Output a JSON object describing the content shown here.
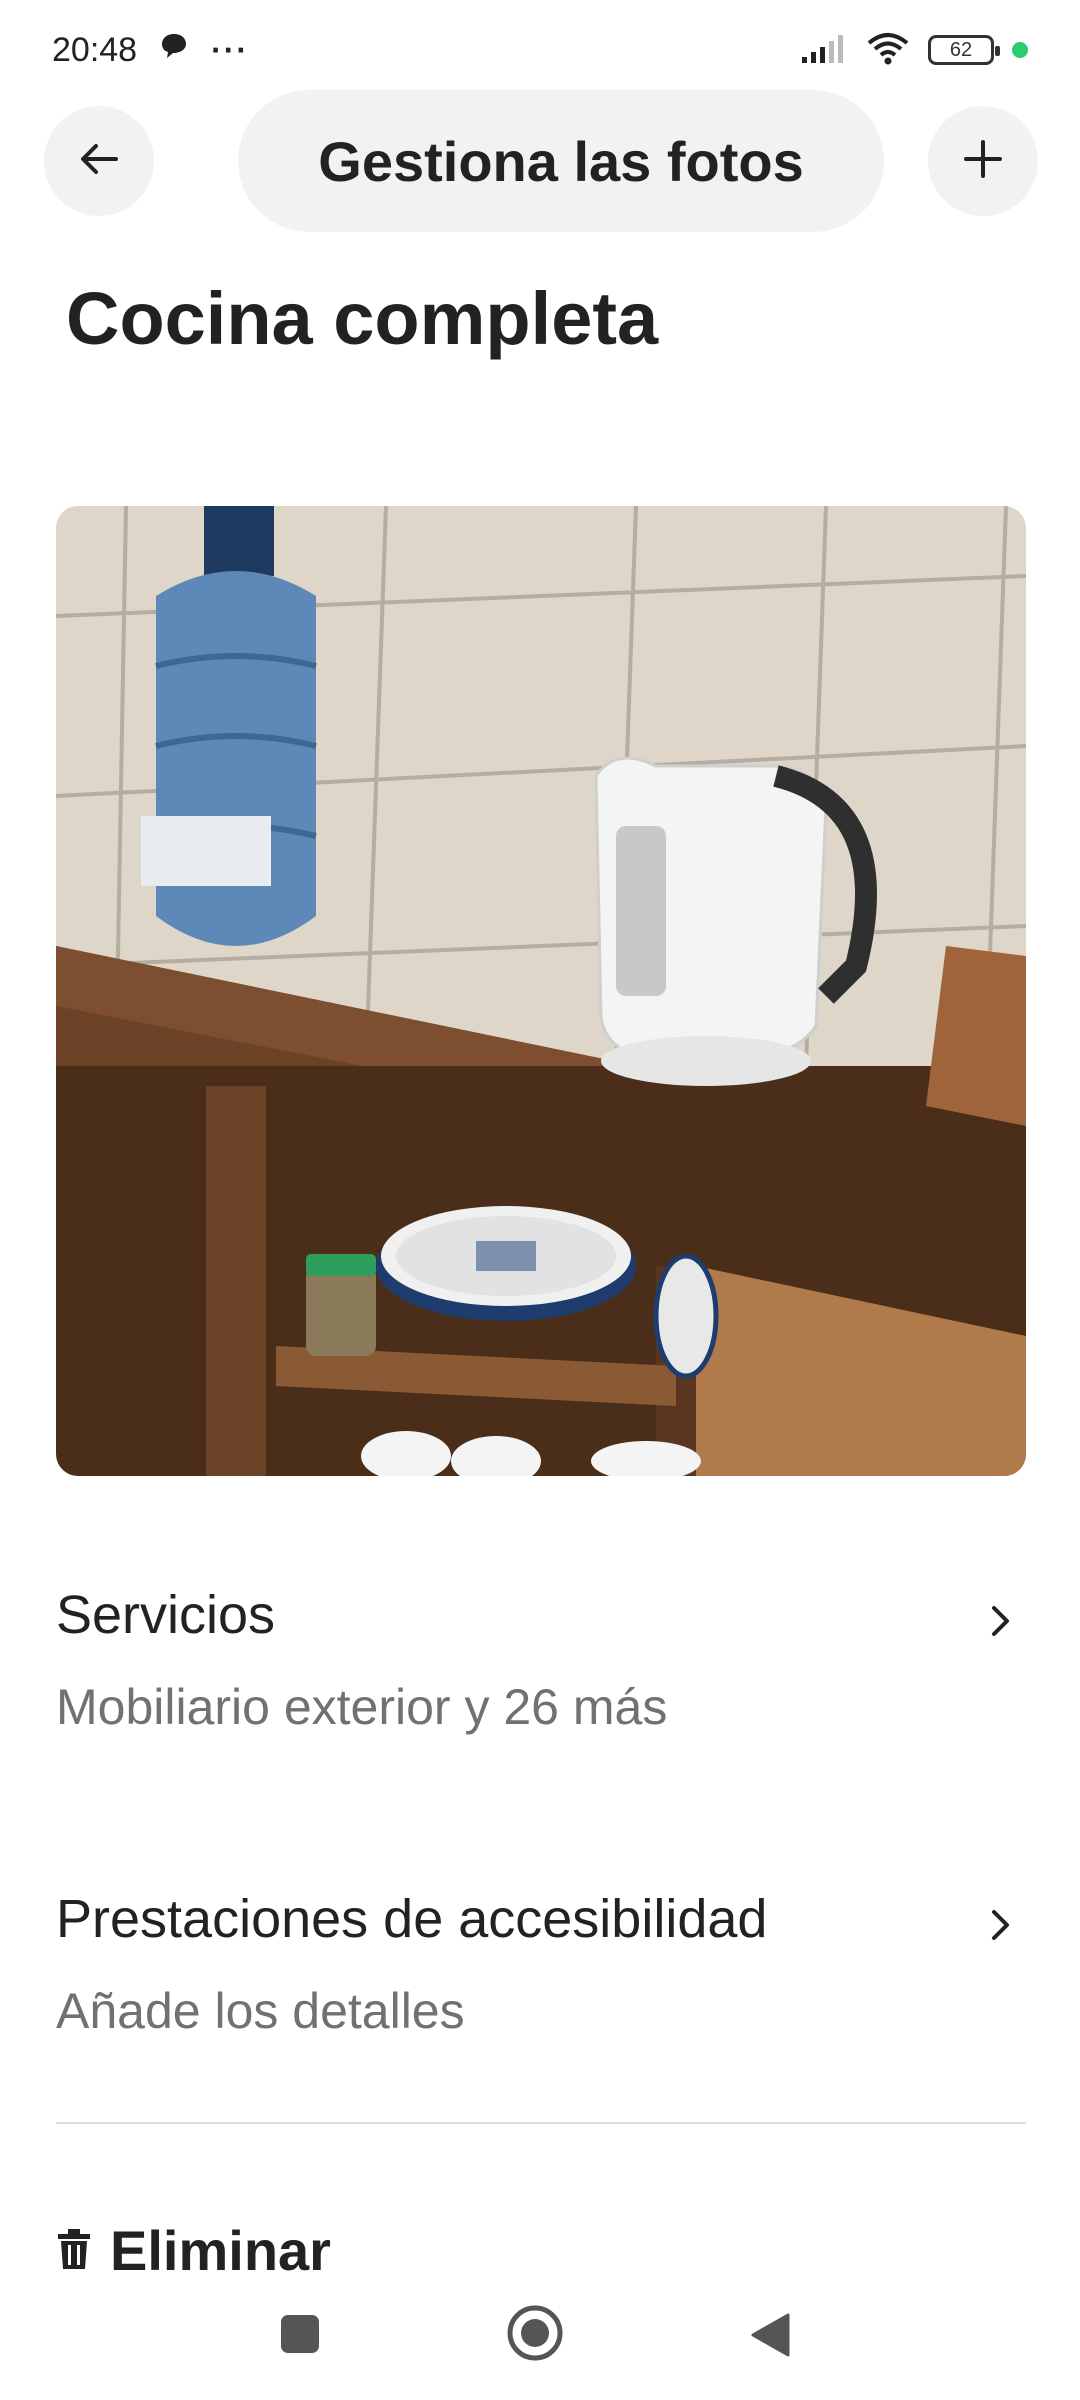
{
  "status_bar": {
    "time": "20:48",
    "notification_icons": [
      "chat-bubble-icon",
      "more-dots-icon"
    ],
    "dots": "···",
    "signal_icon": "signal-icon",
    "wifi_icon": "wifi-icon",
    "battery_level": "62"
  },
  "header": {
    "title": "Gestiona las fotos",
    "back_icon": "arrow-left-icon",
    "add_icon": "plus-icon"
  },
  "page": {
    "title": "Cocina completa"
  },
  "photo": {
    "description_icon": "kitchen-photo"
  },
  "rows": {
    "services": {
      "title": "Servicios",
      "subtitle": "Mobiliario exterior y 26 más"
    },
    "accessibility": {
      "title": "Prestaciones de accesibilidad",
      "subtitle": "Añade los detalles"
    }
  },
  "actions": {
    "delete_label": "Eliminar",
    "delete_icon": "trash-icon"
  },
  "system_nav": {
    "recents_icon": "square-icon",
    "home_icon": "circle-icon",
    "back_icon": "triangle-back-icon"
  },
  "colors": {
    "pill_bg": "#f2f2f2",
    "text": "#222222",
    "subtext": "#717171",
    "divider": "#dddddd"
  }
}
